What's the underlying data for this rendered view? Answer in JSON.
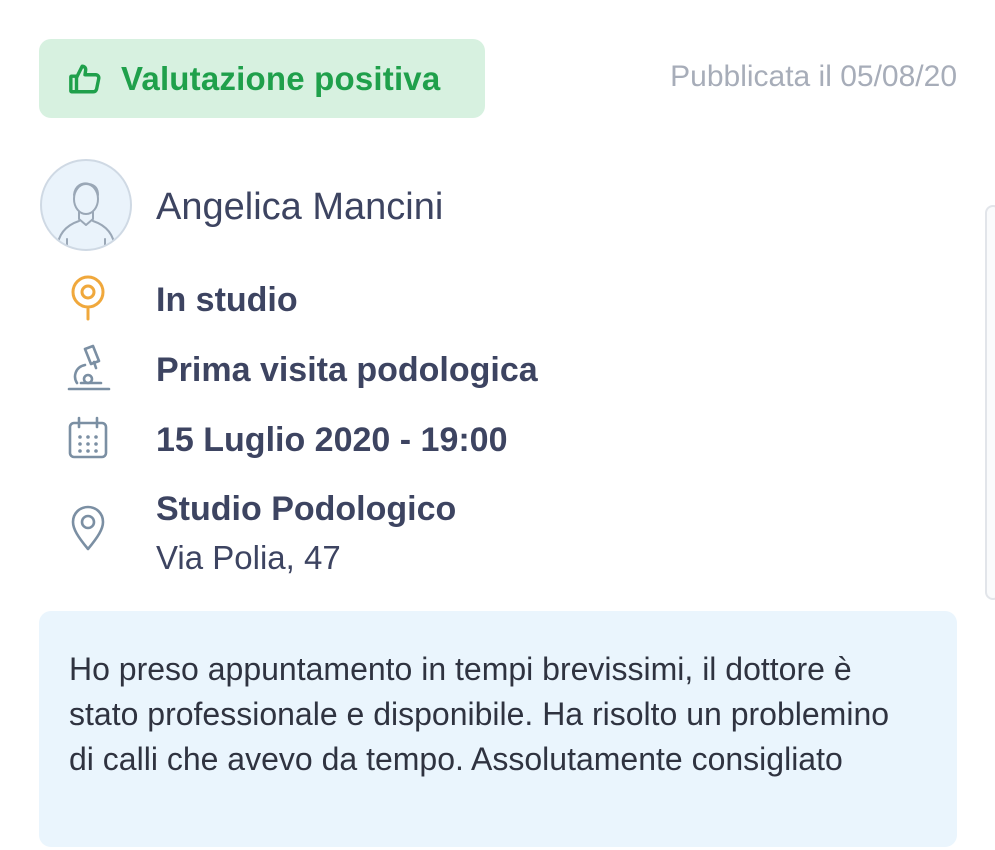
{
  "badge": {
    "label": "Valutazione positiva",
    "icon": "thumbs-up-icon",
    "color": "#1fa04b",
    "background": "#d7f1e0"
  },
  "published": "Pubblicata il 05/08/20",
  "patient": {
    "name": "Angelica Mancini",
    "avatar_icon": "user-avatar-icon"
  },
  "details": {
    "visit_type": {
      "label": "In studio",
      "icon": "location-pin-icon",
      "icon_color": "#f0a83c"
    },
    "service": {
      "label": "Prima visita podologica",
      "icon": "microscope-icon"
    },
    "datetime": {
      "label": "15 Luglio 2020 - 19:00",
      "icon": "calendar-icon"
    },
    "address": {
      "name": "Studio Podologico",
      "street": "Via Polia, 47",
      "icon": "map-pin-icon"
    }
  },
  "review": {
    "text": "Ho preso appuntamento in tempi brevissimi, il dottore è stato professionale e disponibile. Ha risolto un problemino di calli che avevo da tempo. Assolutamente consigliato"
  }
}
